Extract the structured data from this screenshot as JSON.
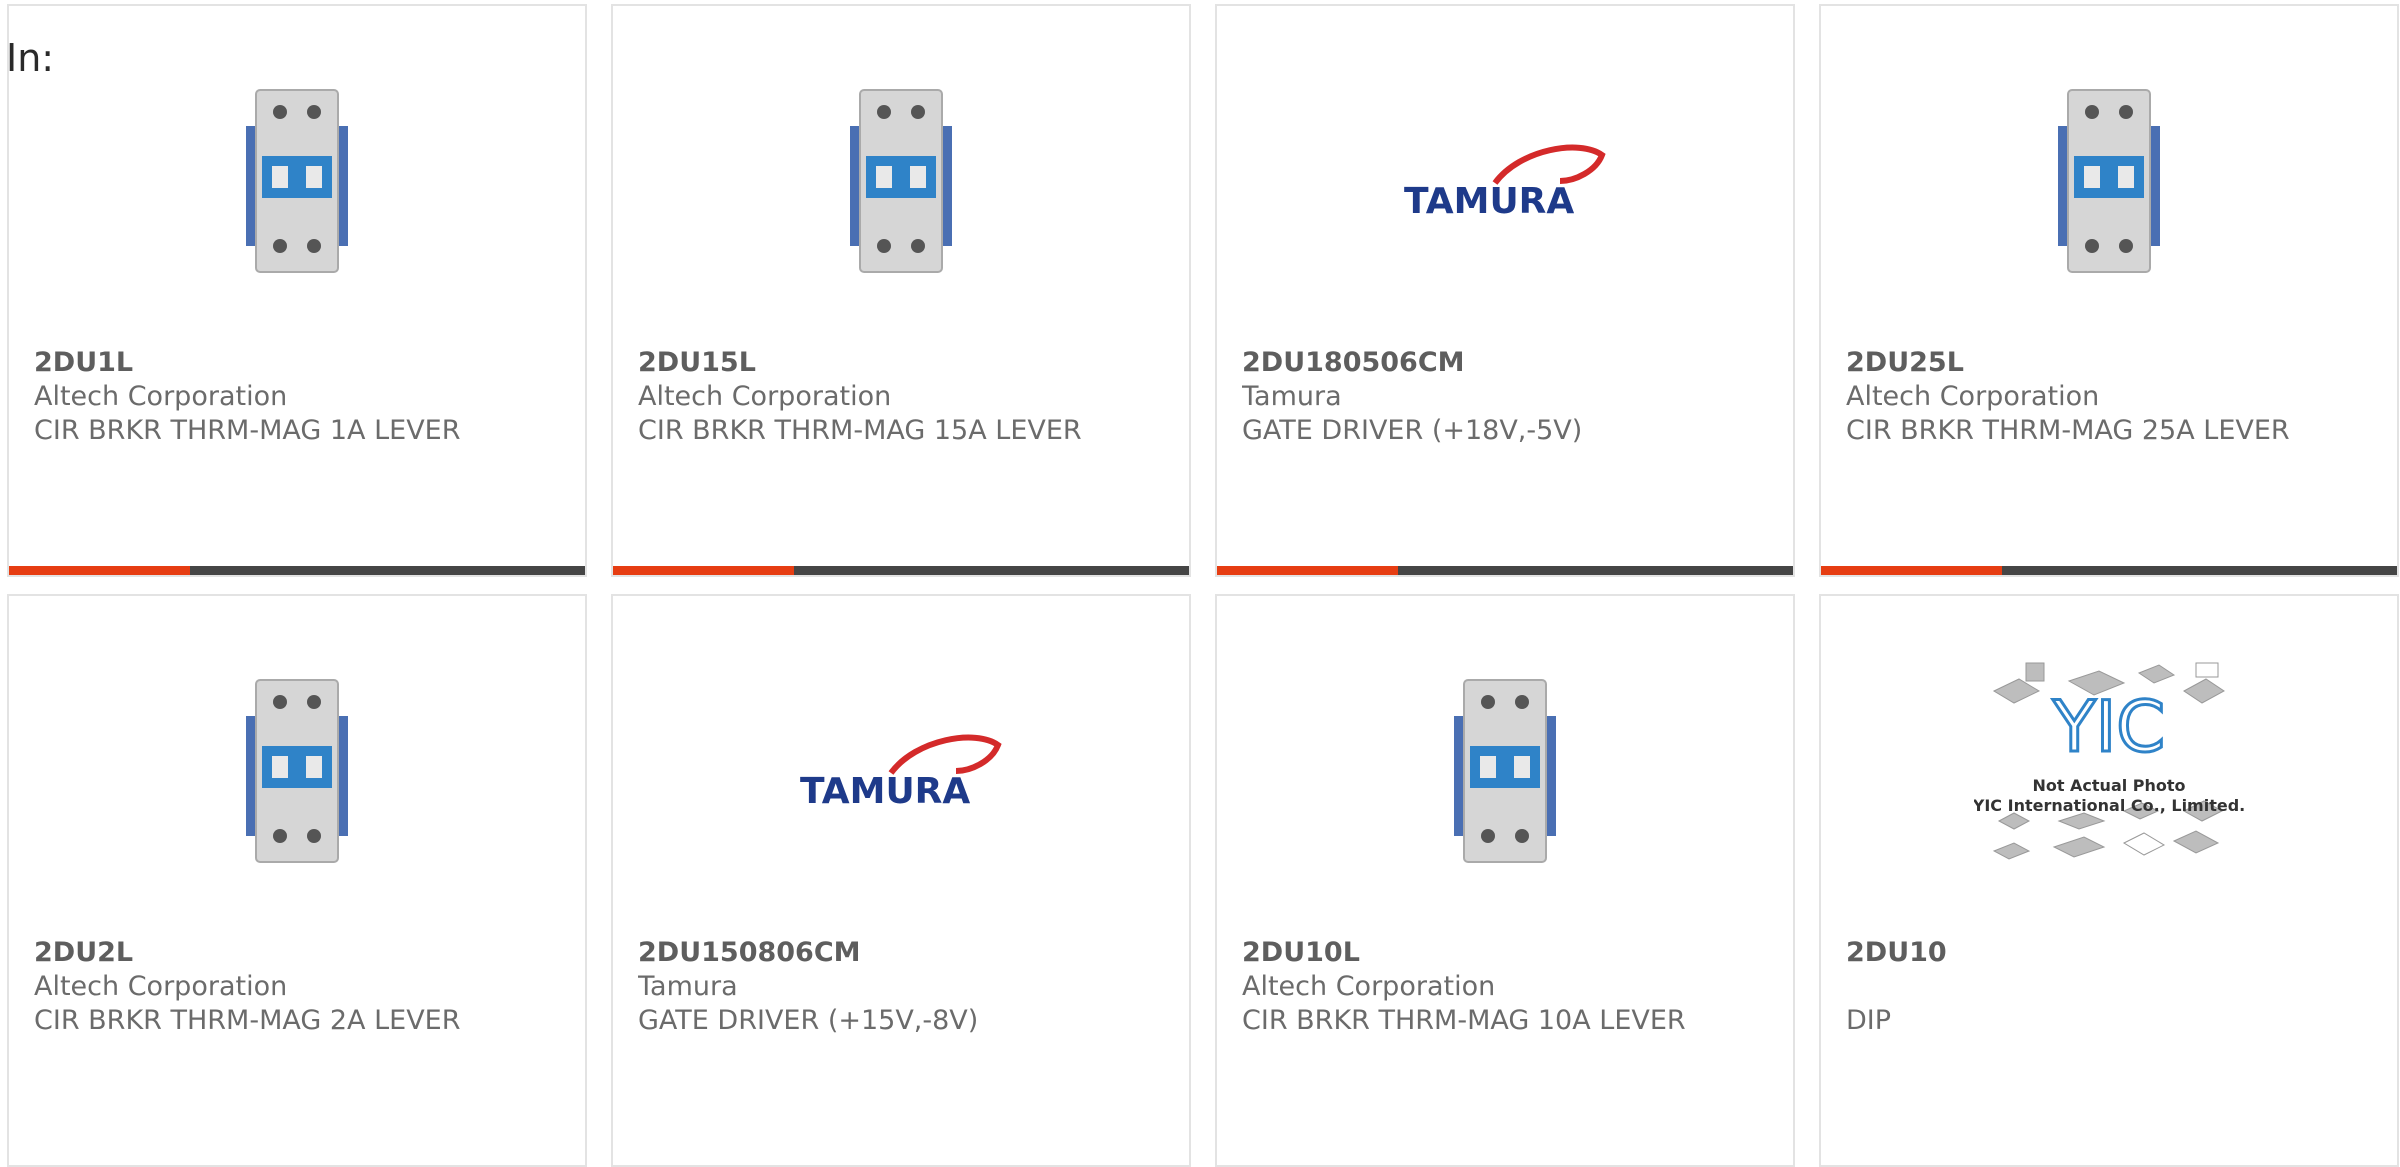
{
  "page": {
    "label": "In:"
  },
  "colors": {
    "accent": "#e63d12",
    "bar_dark": "#454545",
    "tamura_blue": "#1e3a8a",
    "tamura_red": "#d42a2a",
    "breaker_blue": "#2f83c8"
  },
  "products": [
    {
      "part_number": "2DU1L",
      "manufacturer": "Altech Corporation",
      "description": "CIR BRKR THRM-MAG 1A LEVER",
      "image": "circuit-breaker-image"
    },
    {
      "part_number": "2DU15L",
      "manufacturer": "Altech Corporation",
      "description": "CIR BRKR THRM-MAG 15A LEVER",
      "image": "circuit-breaker-image"
    },
    {
      "part_number": "2DU180506CM",
      "manufacturer": "Tamura",
      "description": "GATE DRIVER (+18V,-5V)",
      "image": "tamura-logo",
      "logo_text": "TAMURA"
    },
    {
      "part_number": "2DU25L",
      "manufacturer": "Altech Corporation",
      "description": "CIR BRKR THRM-MAG 25A LEVER",
      "image": "circuit-breaker-image"
    },
    {
      "part_number": "2DU2L",
      "manufacturer": "Altech Corporation",
      "description": "CIR BRKR THRM-MAG 2A LEVER",
      "image": "circuit-breaker-image"
    },
    {
      "part_number": "2DU150806CM",
      "manufacturer": "Tamura",
      "description": "GATE DRIVER (+15V,-8V)",
      "image": "tamura-logo",
      "logo_text": "TAMURA"
    },
    {
      "part_number": "2DU10L",
      "manufacturer": "Altech Corporation",
      "description": "CIR BRKR THRM-MAG 10A LEVER",
      "image": "circuit-breaker-image"
    },
    {
      "part_number": "2DU10",
      "manufacturer": "",
      "description": "DIP",
      "image": "yic-placeholder-image",
      "placeholder_line1": "Not Actual Photo",
      "placeholder_line2": "YIC International Co., Limited."
    }
  ]
}
